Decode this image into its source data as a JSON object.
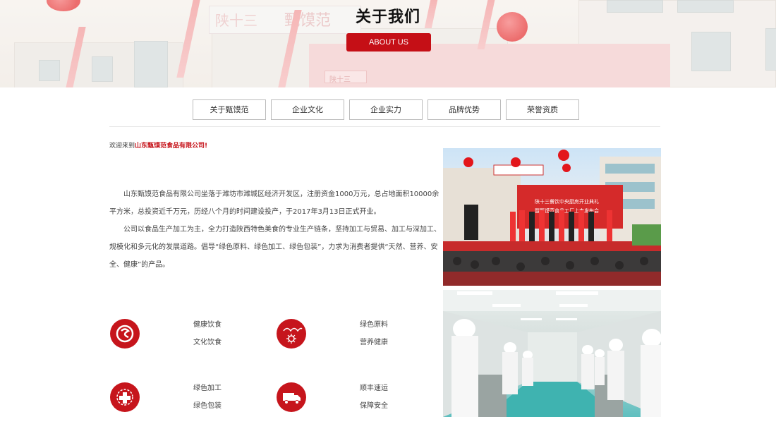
{
  "banner": {
    "title": "关于我们",
    "button_label": "ABOUT US",
    "sign_text_1": "陕十三",
    "sign_text_2": "甄馍范",
    "sign_text_small": "陕十三"
  },
  "tabs": [
    "关于甄馍范",
    "企业文化",
    "企业实力",
    "品牌优势",
    "荣誉资质"
  ],
  "welcome": {
    "prefix": "欢迎来到",
    "company": "山东甄馍范食品有限公司!"
  },
  "intro": {
    "p1": "山东甄馍范食品有限公司坐落于潍坊市潍城区经济开发区，注册资金1000万元，总占地面积10000余平方米，总投资近千万元，历经八个月的时间建设投产，于2017年3月13日正式开业。",
    "p2": "公司以食品生产加工为主，全力打造陕西特色美食的专业生产链条，坚持加工与贸易、加工与深加工、规模化和多元化的发展道路。倡导“绿色原料、绿色加工、绿色包装”，力求为消费者提供“天然、营养、安全、健康”的产品。"
  },
  "features": [
    {
      "icon": "food-logo-icon",
      "line1": "健康饮食",
      "line2": "文化饮食"
    },
    {
      "icon": "wheat-icon",
      "line1": "绿色原料",
      "line2": "营养健康"
    },
    {
      "icon": "health-cross-icon",
      "line1": "绿色加工",
      "line2": "绿色包装"
    },
    {
      "icon": "delivery-truck-icon",
      "line1": "顺丰速运",
      "line2": "保障安全"
    }
  ],
  "photos": {
    "event_banner_line1": "陕十三餐饮中央厨房开业典礼",
    "event_banner_line2": "暨甄馍范食品工厂上市发布会",
    "event_side_text": "潍"
  },
  "colors": {
    "accent": "#c50f16",
    "icon_bg": "#c6151c"
  }
}
